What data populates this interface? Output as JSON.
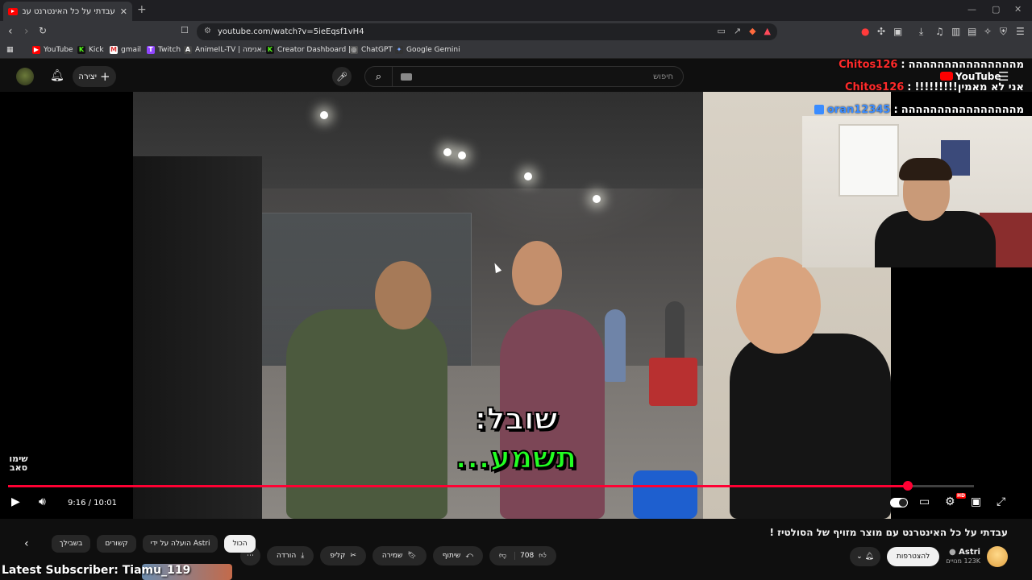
{
  "browser": {
    "tab_title": "עבדתי על כל האינטרנט עם מוצר",
    "url": "youtube.com/watch?v=5ieEqsf1vH4",
    "bookmarks": [
      "YouTube",
      "Kick",
      "gmail",
      "Twitch",
      "AnimeIL-TV | אנימה...",
      "Creator Dashboard |...",
      "ChatGPT",
      "Google Gemini"
    ]
  },
  "header": {
    "create_label": "יצירה",
    "search_placeholder": "חיפוש",
    "overlay_logo": "YouTube"
  },
  "chat": [
    {
      "user": "",
      "message": "מההההההההההההההה"
    },
    {
      "user": "Chitos126",
      "message": "אני לא מאמין!!!!!!!!!"
    },
    {
      "user": "oran12345",
      "message": "מהההההההההההההההה"
    }
  ],
  "chat_first_user": "Chitos126",
  "video": {
    "subtitle_line1": "שובל:",
    "subtitle_line2": "תשמע...",
    "watermark": "שימו סאב",
    "time": "9:16 / 10:01",
    "progress": 0.9318
  },
  "below": {
    "title": "עבדתי על כל האינטרנט עם מוצר מזויף של הסולטיז !",
    "channel_name": "Astri",
    "channel_subs": "123K מנויים",
    "subscribe_label": "להצטרפות",
    "like_count": "708",
    "share_label": "שיתוף",
    "save_label": "שמירה",
    "clip_label": "קליפ",
    "download_label": "הורדה",
    "chips": [
      "הכול",
      "הועלה על ידי Astri",
      "קשורים",
      "בשבילך"
    ]
  },
  "overlay": {
    "latest_subscriber": "Latest Subscriber: Tiamu_119"
  },
  "colors": {
    "progress": "#ff0033",
    "chat_user": "#ff2a2a",
    "chat_user_alt": "#3a8cff",
    "subtitle_highlight": "#22ff22"
  }
}
